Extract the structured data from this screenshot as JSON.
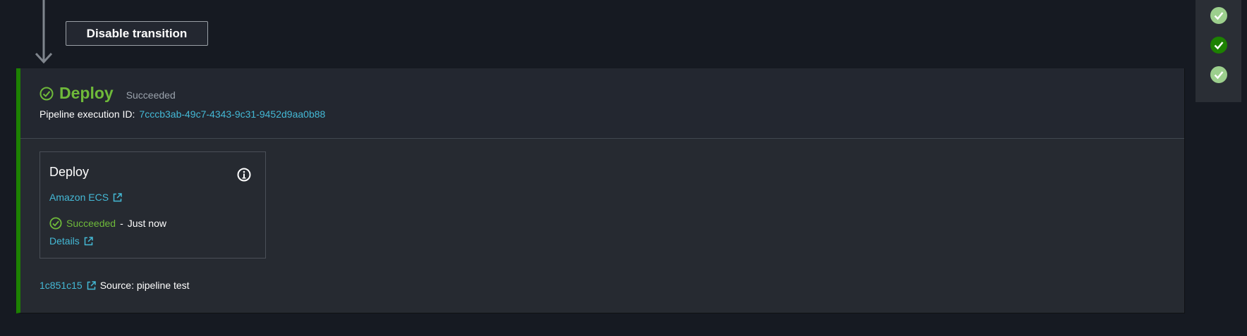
{
  "transition": {
    "disable_label": "Disable transition"
  },
  "stage": {
    "title": "Deploy",
    "status": "Succeeded",
    "execution_label": "Pipeline execution ID:",
    "execution_id": "7cccb3ab-49c7-4343-9c31-9452d9aa0b88"
  },
  "action": {
    "name": "Deploy",
    "provider": "Amazon ECS",
    "status": "Succeeded",
    "separator": "-",
    "time": "Just now",
    "details_label": "Details"
  },
  "source": {
    "commit_id": "1c851c15",
    "text": "Source: pipeline test"
  },
  "minimap": {
    "stages": [
      {
        "status": "succeeded",
        "active": false
      },
      {
        "status": "succeeded",
        "active": true
      },
      {
        "status": "succeeded",
        "active": false
      }
    ]
  },
  "colors": {
    "success": "#6fba3a",
    "success_border": "#1d8102",
    "link": "#44b9d6",
    "background": "#161a22",
    "panel": "#262a31"
  },
  "icons": {
    "status": "check-circle-icon",
    "external": "external-link-icon",
    "info": "info-icon",
    "arrow": "arrow-down-icon"
  }
}
